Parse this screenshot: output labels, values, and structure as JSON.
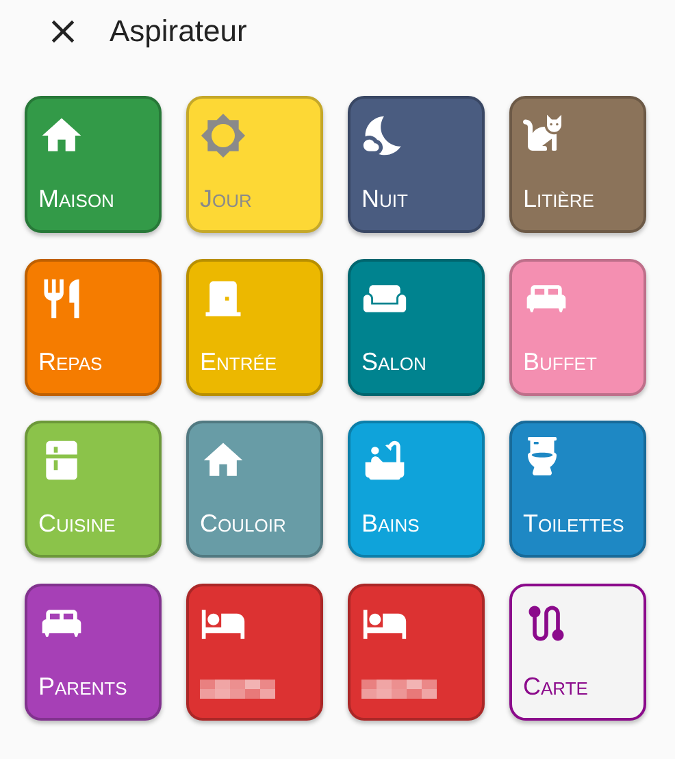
{
  "header": {
    "title": "Aspirateur"
  },
  "tiles": [
    {
      "label": "Maison",
      "color": "#339a48"
    },
    {
      "label": "Jour",
      "color": "#fdd835"
    },
    {
      "label": "Nuit",
      "color": "#4a5c80"
    },
    {
      "label": "Litière",
      "color": "#8b735a"
    },
    {
      "label": "Repas",
      "color": "#f57c00"
    },
    {
      "label": "Entrée",
      "color": "#ecb800"
    },
    {
      "label": "Salon",
      "color": "#00838f"
    },
    {
      "label": "Buffet",
      "color": "#f48fb1"
    },
    {
      "label": "Cuisine",
      "color": "#8bc34a"
    },
    {
      "label": "Couloir",
      "color": "#689ca6"
    },
    {
      "label": "Bains",
      "color": "#0fa3da"
    },
    {
      "label": "Toilettes",
      "color": "#1e88c4"
    },
    {
      "label": "Parents",
      "color": "#a640b6"
    },
    {
      "kind": "redacted",
      "color": "#dc3232"
    },
    {
      "kind": "redacted",
      "color": "#dc3232"
    },
    {
      "label": "Carte",
      "color": "#f4f4f4"
    }
  ]
}
